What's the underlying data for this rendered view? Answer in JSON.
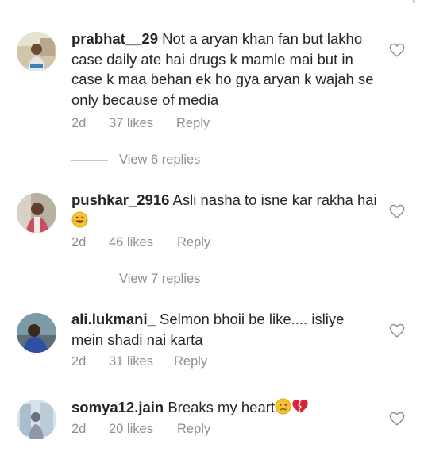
{
  "comments": [
    {
      "username": "prabhat__29",
      "text": "Not a aryan khan fan but lakho case daily ate hai drugs k mamle mai but in case k maa behan ek ho gya aryan k wajah se only because of media",
      "time": "2d",
      "likes": "37 likes",
      "reply": "Reply",
      "view_replies": "View 6 replies",
      "avatar_icon": "avatar-photo"
    },
    {
      "username": "pushkar_2916",
      "text": "Asli nasha to isne  kar rakha hai",
      "emoji": "laughing-tears-emoji",
      "time": "2d",
      "likes": "46 likes",
      "reply": "Reply",
      "view_replies": "View 7 replies",
      "avatar_icon": "avatar-photo"
    },
    {
      "username": "ali.lukmani_",
      "text": "Selmon bhoii be like.... isliye mein shadi nai karta",
      "time": "2d",
      "likes": "31 likes",
      "reply": "Reply",
      "avatar_icon": "avatar-photo"
    },
    {
      "username": "somya12.jain",
      "text": "Breaks my heart",
      "emoji": [
        "crying-face-emoji",
        "broken-heart-emoji"
      ],
      "time": "2d",
      "likes": "20 likes",
      "reply": "Reply",
      "avatar_icon": "avatar-photo"
    }
  ],
  "icons": {
    "like": "heart-outline-icon"
  },
  "colors": {
    "text": "#262626",
    "secondary": "#8e8e8e",
    "divider": "#c7c7c7",
    "background": "#ffffff"
  }
}
